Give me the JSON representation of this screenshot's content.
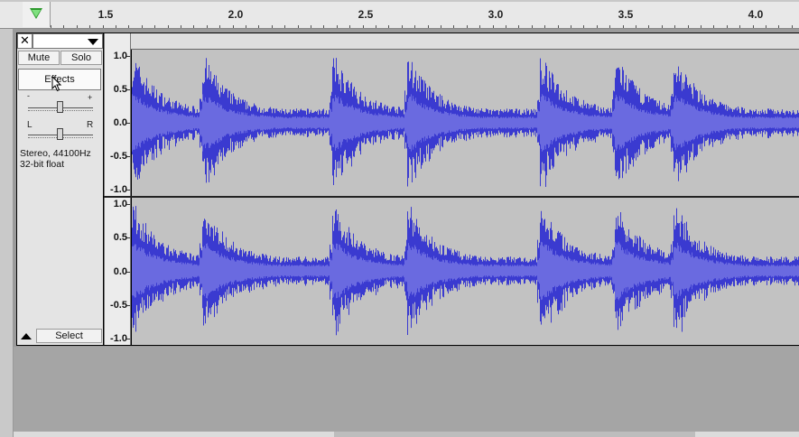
{
  "ruler": {
    "ticks": [
      {
        "label": "1.5",
        "pos": 117
      },
      {
        "label": "2.0",
        "pos": 261
      },
      {
        "label": "2.5",
        "pos": 405
      },
      {
        "label": "3.0",
        "pos": 549
      },
      {
        "label": "3.5",
        "pos": 693
      },
      {
        "label": "4.0",
        "pos": 837
      }
    ]
  },
  "track": {
    "close_label": "✕",
    "name": "",
    "mute_label": "Mute",
    "solo_label": "Solo",
    "effects_label": "Effects",
    "gain_minus": "-",
    "gain_plus": "+",
    "pan_left": "L",
    "pan_right": "R",
    "info_line1": "Stereo, 44100Hz",
    "info_line2": "32-bit float",
    "select_label": "Select"
  },
  "scale": {
    "labels": [
      "1.0",
      "0.5",
      "0.0",
      "-0.5",
      "-1.0"
    ]
  },
  "colors": {
    "wave": "#3a3ad0",
    "wave_light": "#6a6ae0",
    "wave_bg": "#c2c2c2"
  }
}
